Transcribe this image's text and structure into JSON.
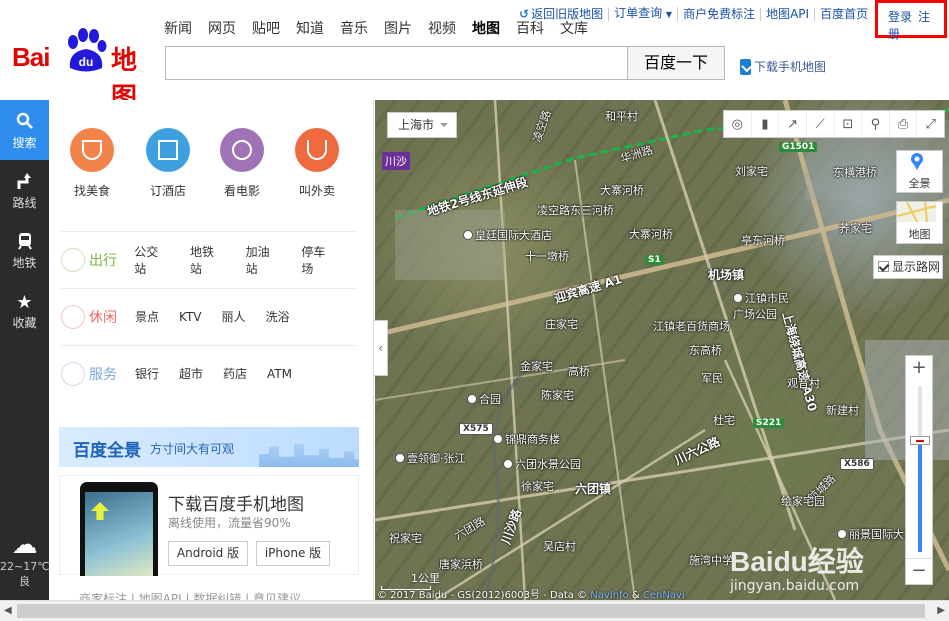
{
  "header": {
    "logo_text_left": "Bai",
    "logo_text_paw": "du",
    "logo_text_right": "地图",
    "nav": [
      {
        "label": "新闻",
        "active": false
      },
      {
        "label": "网页",
        "active": false
      },
      {
        "label": "贴吧",
        "active": false
      },
      {
        "label": "知道",
        "active": false
      },
      {
        "label": "音乐",
        "active": false
      },
      {
        "label": "图片",
        "active": false
      },
      {
        "label": "视频",
        "active": false
      },
      {
        "label": "地图",
        "active": true
      },
      {
        "label": "百科",
        "active": false
      },
      {
        "label": "文库",
        "active": false
      }
    ],
    "search_value": "",
    "search_button": "百度一下",
    "download_link": "下载手机地图",
    "top_links": [
      "返回旧版地图",
      "订单查询",
      "商户免费标注",
      "地图API",
      "百度首页"
    ],
    "login": "登录",
    "register": "注册"
  },
  "sidebar": {
    "items": [
      {
        "label": "搜索",
        "icon": "search-icon"
      },
      {
        "label": "路线",
        "icon": "route-icon"
      },
      {
        "label": "地铁",
        "icon": "subway-icon"
      },
      {
        "label": "收藏",
        "icon": "star-icon"
      }
    ],
    "weather_temp": "22~17℃",
    "weather_quality": "良"
  },
  "panel": {
    "quick": [
      {
        "label": "找美食",
        "color": "#f2834a"
      },
      {
        "label": "订酒店",
        "color": "#3fa0e0"
      },
      {
        "label": "看电影",
        "color": "#a073b6"
      },
      {
        "label": "叫外卖",
        "color": "#ef6a3e"
      }
    ],
    "categories": [
      {
        "title": "出行",
        "color": "#7ab540",
        "items": [
          "公交站",
          "地铁站",
          "加油站",
          "停车场"
        ]
      },
      {
        "title": "休闲",
        "color": "#ec6a6a",
        "items": [
          "景点",
          "KTV",
          "丽人",
          "洗浴"
        ]
      },
      {
        "title": "服务",
        "color": "#7ea7d8",
        "items": [
          "银行",
          "超市",
          "药店",
          "ATM"
        ]
      }
    ],
    "pano_title": "百度全景",
    "pano_sub": "方寸间大有可观",
    "download_title": "下载百度手机地图",
    "download_sub": "离线使用，流量省90%",
    "android_btn": "Android 版",
    "iphone_btn": "iPhone 版",
    "footer": "商家标注 | 地图API | 数据纠错 | 意见建议"
  },
  "map": {
    "city": "上海市",
    "district_tag": "川沙",
    "toolbar_icons": [
      "ranging-icon",
      "traffic-icon",
      "share-icon",
      "ruler-icon",
      "fullscreen-mark-icon",
      "pin-icon",
      "print-icon",
      "expand-icon"
    ],
    "pano_view": "全景",
    "map_view": "地图",
    "roadnet_label": "显示路网",
    "scale_label": "1公里",
    "copyright": "© 2017 Baidu - GS(2012)6003号 - Data © ",
    "copyright_link1": "NavInfo",
    "copyright_amp": " & ",
    "copyright_link2": "CenNavi",
    "watermark": "Baidu经验",
    "watermark_sub": "jingyan.baidu.com",
    "labels": [
      {
        "text": "凌空路",
        "cls": ""
      },
      {
        "text": "和平村",
        "cls": ""
      },
      {
        "text": "地铁2号线东延伸段",
        "cls": "big"
      },
      {
        "text": "华洲路",
        "cls": ""
      },
      {
        "text": "大寨河桥",
        "cls": ""
      },
      {
        "text": "凌空路东三河桥",
        "cls": ""
      },
      {
        "text": "刘家宅",
        "cls": ""
      },
      {
        "text": "东横港桥",
        "cls": ""
      },
      {
        "text": "皇廷国际大酒店",
        "cls": "poi"
      },
      {
        "text": "大寨河桥",
        "cls": ""
      },
      {
        "text": "亭东河桥",
        "cls": ""
      },
      {
        "text": "荞家宅",
        "cls": ""
      },
      {
        "text": "十一墩桥",
        "cls": ""
      },
      {
        "text": "机场镇",
        "cls": "big"
      },
      {
        "text": "迎宾高速 A1",
        "cls": "big"
      },
      {
        "text": "江镇市民广场公园",
        "cls": "poi"
      },
      {
        "text": "庄家宅",
        "cls": ""
      },
      {
        "text": "江镇老百货商场",
        "cls": ""
      },
      {
        "text": "上海绕城高速 A30",
        "cls": "big"
      },
      {
        "text": "东高桥",
        "cls": ""
      },
      {
        "text": "金家宅",
        "cls": ""
      },
      {
        "text": "高桥",
        "cls": ""
      },
      {
        "text": "陈家宅",
        "cls": ""
      },
      {
        "text": "合园",
        "cls": "poi"
      },
      {
        "text": "观音村",
        "cls": ""
      },
      {
        "text": "军民",
        "cls": ""
      },
      {
        "text": "新建村",
        "cls": ""
      },
      {
        "text": "杜宅",
        "cls": ""
      },
      {
        "text": "锦鼎商务楼",
        "cls": "poi"
      },
      {
        "text": "川六公路",
        "cls": "big"
      },
      {
        "text": "壹领御·张江",
        "cls": "poi"
      },
      {
        "text": "六团水景公园",
        "cls": "poi"
      },
      {
        "text": "航城路",
        "cls": ""
      },
      {
        "text": "六团镇",
        "cls": "big"
      },
      {
        "text": "六团路",
        "cls": ""
      },
      {
        "text": "徐家宅",
        "cls": ""
      },
      {
        "text": "绘家宅园",
        "cls": ""
      },
      {
        "text": "丽景国际大酒店",
        "cls": "poi"
      },
      {
        "text": "川沙路",
        "cls": "big"
      },
      {
        "text": "祝家宅",
        "cls": ""
      },
      {
        "text": "吴店村",
        "cls": ""
      },
      {
        "text": "唐家浜桥",
        "cls": ""
      },
      {
        "text": "施湾中学",
        "cls": ""
      }
    ],
    "shields": [
      {
        "text": "G1501",
        "cls": "green"
      },
      {
        "text": "S1",
        "cls": "green"
      },
      {
        "text": "S221",
        "cls": "green"
      },
      {
        "text": "X575",
        "cls": "white"
      },
      {
        "text": "X586",
        "cls": "white"
      }
    ]
  },
  "colors": {
    "accent": "#2e8ded",
    "brand": "#e10601",
    "highlight_box": "#ff0000"
  }
}
